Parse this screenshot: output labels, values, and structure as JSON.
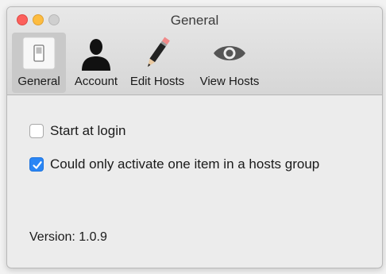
{
  "window": {
    "title": "General"
  },
  "toolbar": {
    "tabs": [
      {
        "label": "General",
        "icon": "switch-icon",
        "selected": true
      },
      {
        "label": "Account",
        "icon": "person-silhouette-icon",
        "selected": false
      },
      {
        "label": "Edit Hosts",
        "icon": "pencil-icon",
        "selected": false
      },
      {
        "label": "View Hosts",
        "icon": "eye-icon",
        "selected": false
      }
    ]
  },
  "settings": {
    "start_at_login": {
      "label": "Start at login",
      "checked": false
    },
    "single_active_item": {
      "label": "Could only activate one item in a hosts group",
      "checked": true
    }
  },
  "footer": {
    "version": "Version: 1.0.9"
  },
  "colors": {
    "accent": "#2a86f5",
    "close": "#fc605c",
    "minimize": "#fdbc40",
    "zoom_disabled": "#cfcfcf"
  }
}
